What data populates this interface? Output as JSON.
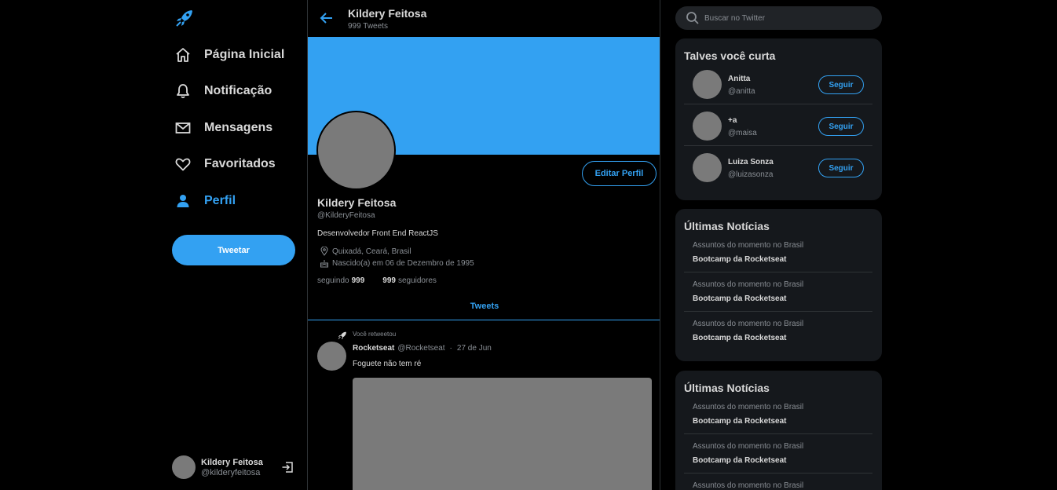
{
  "colors": {
    "accent": "#33a1f2",
    "background": "#000000",
    "card": "#15181c",
    "placeholder_gray": "#7a7a7a"
  },
  "menu": {
    "logo_icon": "rocket-icon",
    "items": [
      {
        "label": "Página Inicial",
        "icon": "home-icon"
      },
      {
        "label": "Notificação",
        "icon": "bell-icon"
      },
      {
        "label": "Mensagens",
        "icon": "mail-icon"
      },
      {
        "label": "Favoritados",
        "icon": "heart-icon"
      },
      {
        "label": "Perfil",
        "icon": "person-icon",
        "active": true
      }
    ],
    "tweet_button": "Tweetar",
    "user": {
      "name": "Kildery Feitosa",
      "handle": "@kilderyfeitosa"
    }
  },
  "header": {
    "title": "Kildery Feitosa",
    "subtitle": "999 Tweets"
  },
  "profile": {
    "edit_button": "Editar Perfil",
    "name": "Kildery Feitosa",
    "handle": "@KilderyFeitosa",
    "bio": "Desenvolvedor Front End ReactJS",
    "location": "Quixadá, Ceará, Brasil",
    "birth": "Nascido(a) em 06 de Dezembro de 1995",
    "following_label": "seguindo",
    "following_count": "999",
    "followers_count": "999",
    "followers_label": "seguidores",
    "tab": "Tweets"
  },
  "tweet": {
    "retweet_label": "Você retweetou",
    "author": "Rocketseat",
    "handle": "@Rocketseat",
    "separator": "·",
    "date": "27 de Jun",
    "text": "Foguete não tem ré"
  },
  "sidebar": {
    "search_placeholder": "Buscar no Twitter",
    "suggestions_title": "Talves você curta",
    "suggestions": [
      {
        "name": "Anitta",
        "handle": "@anitta",
        "button": "Seguir"
      },
      {
        "name": "+a",
        "handle": "@maisa",
        "button": "Seguir"
      },
      {
        "name": "Luiza Sonza",
        "handle": "@luizasonza",
        "button": "Seguir"
      }
    ],
    "news_cards": [
      {
        "title": "Últimas Notícias",
        "items": [
          {
            "topic": "Assuntos do momento no Brasil",
            "headline": "Bootcamp da Rocketseat"
          },
          {
            "topic": "Assuntos do momento no Brasil",
            "headline": "Bootcamp da Rocketseat"
          },
          {
            "topic": "Assuntos do momento no Brasil",
            "headline": "Bootcamp da Rocketseat"
          }
        ]
      },
      {
        "title": "Últimas Notícias",
        "items": [
          {
            "topic": "Assuntos do momento no Brasil",
            "headline": "Bootcamp da Rocketseat"
          },
          {
            "topic": "Assuntos do momento no Brasil",
            "headline": "Bootcamp da Rocketseat"
          },
          {
            "topic": "Assuntos do momento no Brasil"
          }
        ]
      }
    ]
  }
}
